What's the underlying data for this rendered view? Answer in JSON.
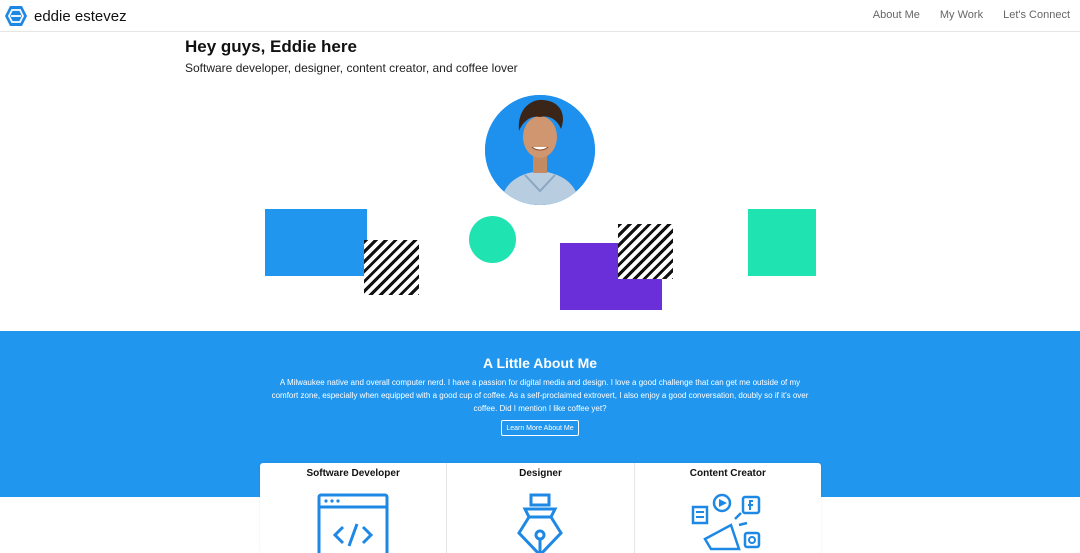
{
  "nav": {
    "brand": "eddie estevez",
    "links": [
      "About Me",
      "My Work",
      "Let's Connect"
    ]
  },
  "hero": {
    "title": "Hey guys, Eddie here",
    "subtitle": "Software developer, designer, content creator, and coffee lover"
  },
  "about": {
    "title": "A Little About Me",
    "body": "A Milwaukee native and overall computer nerd. I have a passion for digital media and design. I love a good challenge that can get me outside of my comfort zone, especially when equipped with a good cup of coffee. As a self-proclaimed extrovert, I also enjoy a good conversation, doubly so if it's over coffee. Did I mention I like coffee yet?",
    "button": "Learn More About Me"
  },
  "cards": [
    {
      "title": "Software Developer",
      "icon": "code-window-icon"
    },
    {
      "title": "Designer",
      "icon": "pen-nib-icon"
    },
    {
      "title": "Content Creator",
      "icon": "megaphone-social-icon"
    }
  ],
  "colors": {
    "accent_blue": "#2196ee",
    "mint": "#20e3b2",
    "purple": "#6a2fd8",
    "stripe": "#111111"
  }
}
